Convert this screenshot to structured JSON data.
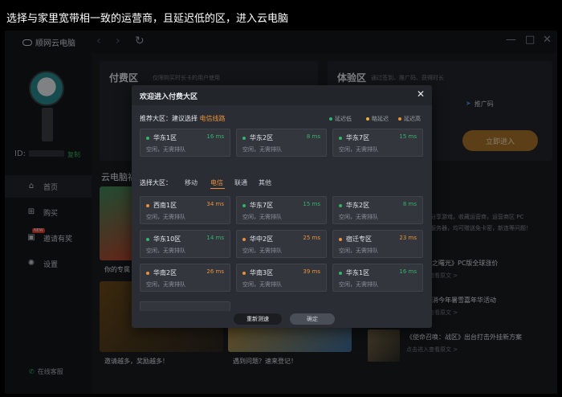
{
  "caption": "选择与家里宽带相一致的运营商，且延迟低的区，进入云电脑",
  "app": {
    "title": "顺网云电脑",
    "colors": {
      "low": "#34b36a",
      "mid": "#e8b13a",
      "high": "#e8913a",
      "accent": "#e8913a"
    }
  },
  "sidebar": {
    "id_label": "ID:",
    "copy_label": "复制",
    "items": [
      {
        "label": "首页",
        "icon": "home-icon"
      },
      {
        "label": "购买",
        "icon": "cart-icon"
      },
      {
        "label": "邀请有奖",
        "icon": "gift-icon",
        "badge": "NEW"
      },
      {
        "label": "设置",
        "icon": "gear-icon"
      }
    ],
    "service": "在线客服"
  },
  "background": {
    "paid_title": "付费区",
    "paid_sub": "仅限购买时长卡的用户使用",
    "trial_title": "体验区",
    "trial_sub": "通过签到、推广码、获得时长",
    "promo_code": "推广码",
    "start_btn": "立即进入",
    "section_title": "云电脑福利",
    "card1_label": "你的专属",
    "card2_label": "邀请越多，奖励越多！",
    "card3_label": "遇到问题？速来登记！",
    "desc_lines": [
      "分享游戏，收藏运营商，运营商区 PC",
      "服务器，均可赠送免卡密，新连等问题！"
    ],
    "news": [
      {
        "title": "黎明的零之曙光》PC版全球涨价",
        "link": "点击进入查看原文 >"
      },
      {
        "title": "后宣布取消今年暑雪嘉年华活动",
        "link": "点击进入查看原文 >"
      },
      {
        "title": "《使命召唤：战区》出台打击外挂新方案",
        "link": "点击进入查看原文 >"
      }
    ]
  },
  "modal": {
    "title": "欢迎进入付费大区",
    "recommend_label": "推荐大区：",
    "recommend_hint": "建议选择",
    "recommend_line": "电信线路",
    "legend": [
      "延迟低",
      "略延迟",
      "延迟高"
    ],
    "recommended": [
      {
        "name": "华东1区",
        "ms": "16 ms",
        "status": "空闲，无需排队",
        "level": "low"
      },
      {
        "name": "华东2区",
        "ms": "8 ms",
        "status": "空闲，无需排队",
        "level": "low"
      },
      {
        "name": "华东7区",
        "ms": "15 ms",
        "status": "空闲，无需排队",
        "level": "low"
      }
    ],
    "select_label": "选择大区：",
    "tabs": [
      "移动",
      "电信",
      "联通",
      "其他"
    ],
    "active_tab": "电信",
    "servers": [
      {
        "name": "西南1区",
        "ms": "34 ms",
        "status": "空闲，无需排队",
        "level": "high"
      },
      {
        "name": "华东7区",
        "ms": "15 ms",
        "status": "空闲，无需排队",
        "level": "low"
      },
      {
        "name": "华东2区",
        "ms": "8 ms",
        "status": "空闲，无需排队",
        "level": "low"
      },
      {
        "name": "华东10区",
        "ms": "14 ms",
        "status": "空闲，无需排队",
        "level": "low"
      },
      {
        "name": "华中2区",
        "ms": "25 ms",
        "status": "空闲，无需排队",
        "level": "high"
      },
      {
        "name": "宿迁专区",
        "ms": "23 ms",
        "status": "空闲，无需排队",
        "level": "high"
      },
      {
        "name": "华南2区",
        "ms": "26 ms",
        "status": "空闲，无需排队",
        "level": "high"
      },
      {
        "name": "华南3区",
        "ms": "39 ms",
        "status": "空闲，无需排队",
        "level": "high"
      },
      {
        "name": "华东1区",
        "ms": "16 ms",
        "status": "空闲，无需排队",
        "level": "low"
      }
    ],
    "retest": "重新测速",
    "confirm": "确定"
  }
}
